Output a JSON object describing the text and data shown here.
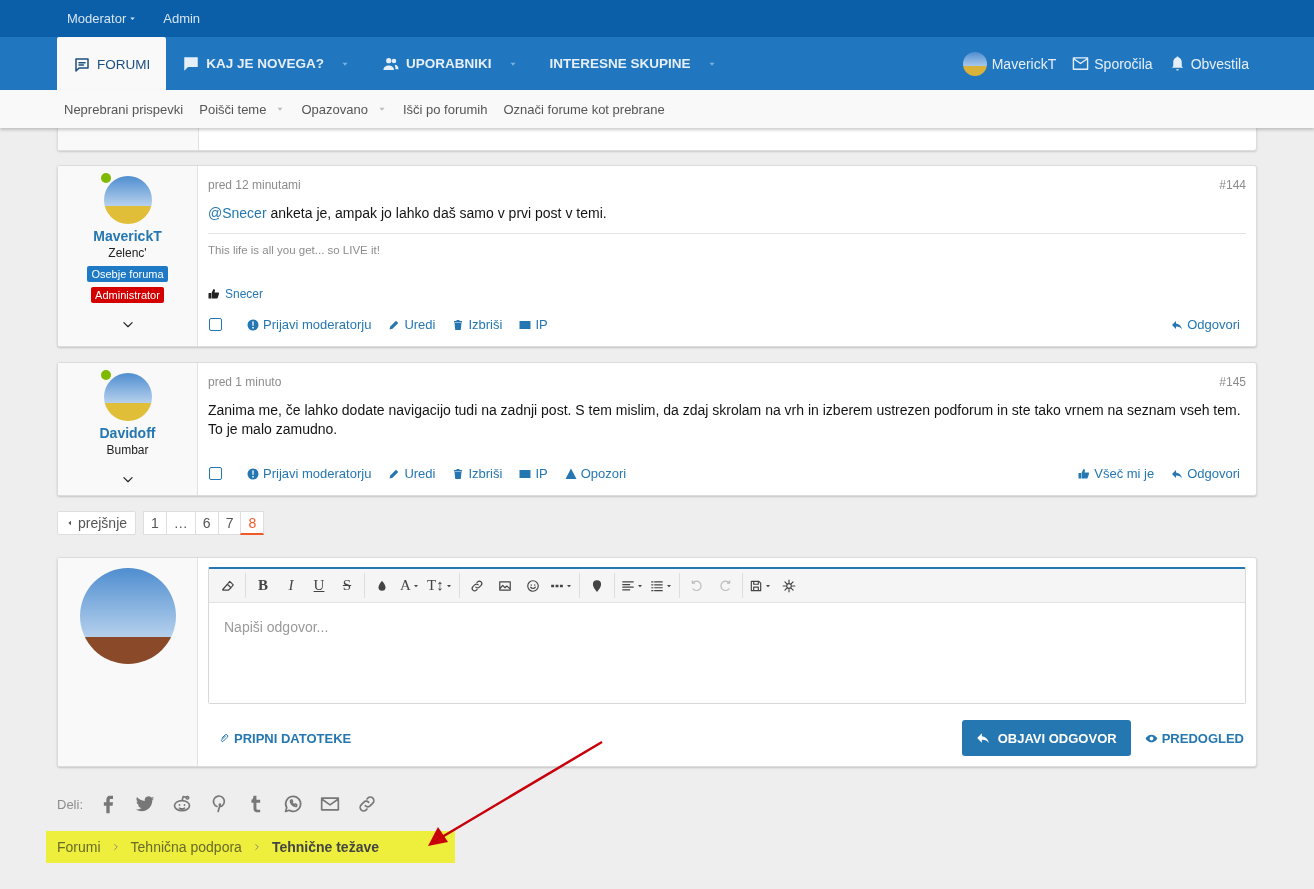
{
  "top_bar": [
    {
      "label": "Moderator",
      "dropdown": true
    },
    {
      "label": "Admin",
      "dropdown": false
    }
  ],
  "main_nav": {
    "tabs": [
      {
        "kind": "forums",
        "label": "FORUMI",
        "selected": true,
        "dropdown": false
      },
      {
        "kind": "news",
        "label": "KAJ JE NOVEGA?",
        "selected": false,
        "dropdown": true
      },
      {
        "kind": "members",
        "label": "UPORABNIKI",
        "selected": false,
        "dropdown": true
      },
      {
        "kind": "groups",
        "label": "INTERESNE SKUPINE",
        "selected": false,
        "dropdown": true
      }
    ],
    "user": "MaverickT",
    "links": [
      {
        "kind": "messages",
        "label": "Sporočila"
      },
      {
        "kind": "alerts",
        "label": "Obvestila"
      }
    ]
  },
  "sub_nav": [
    {
      "label": "Neprebrani prispevki",
      "dropdown": false
    },
    {
      "label": "Poišči teme",
      "dropdown": true
    },
    {
      "label": "Opazovano",
      "dropdown": true
    },
    {
      "label": "Išči po forumih",
      "dropdown": false
    },
    {
      "label": "Označi forume kot prebrane",
      "dropdown": false
    }
  ],
  "posts": [
    {
      "user": "MaverickT",
      "online": true,
      "user_title": "Zelenc'",
      "badges": [
        {
          "label": "Osebje foruma",
          "color": "#1e7ac5"
        },
        {
          "label": "Administrator",
          "color": "#d40000"
        }
      ],
      "time": "pred 12 minutami",
      "number": "#144",
      "mention": "@Snecer",
      "body": "anketa je, ampak jo lahko daš samo v prvi post v temi.",
      "signature": "This life is all you get... so LIVE it!",
      "liked_by": "Snecer",
      "checked": false,
      "actions": [
        {
          "kind": "report",
          "label": "Prijavi moderatorju"
        },
        {
          "kind": "edit",
          "label": "Uredi"
        },
        {
          "kind": "delete",
          "label": "Izbriši"
        },
        {
          "kind": "ip",
          "label": "IP"
        }
      ],
      "right_actions": [
        {
          "kind": "reply",
          "label": "Odgovori"
        }
      ]
    },
    {
      "user": "Davidoff",
      "online": true,
      "user_title": "Bumbar",
      "time": "pred 1 minuto",
      "number": "#145",
      "body": "Zanima me, če lahko dodate navigacijo tudi na zadnji post. S tem mislim, da zdaj skrolam na vrh in izberem ustrezen podforum in ste tako vrnem na seznam vseh tem. To je malo zamudno.",
      "checked": false,
      "actions": [
        {
          "kind": "report",
          "label": "Prijavi moderatorju"
        },
        {
          "kind": "edit",
          "label": "Uredi"
        },
        {
          "kind": "delete",
          "label": "Izbriši"
        },
        {
          "kind": "ip",
          "label": "IP"
        },
        {
          "kind": "warn",
          "label": "Opozori"
        }
      ],
      "right_actions": [
        {
          "kind": "like",
          "label": "Všeč mi je"
        },
        {
          "kind": "reply",
          "label": "Odgovori"
        }
      ]
    }
  ],
  "pagination": {
    "prev": "prejšnje",
    "pages": [
      {
        "label": "1",
        "selected": false
      },
      {
        "label": "…",
        "selected": false
      },
      {
        "label": "6",
        "selected": false
      },
      {
        "label": "7",
        "selected": false
      },
      {
        "label": "8",
        "selected": true
      }
    ]
  },
  "reply": {
    "toolbar": [
      [
        {
          "kind": "eraser",
          "dropdown": false,
          "disabled": false
        }
      ],
      [
        {
          "kind": "bold",
          "label": "B",
          "dropdown": false,
          "disabled": false
        },
        {
          "kind": "italic",
          "label": "I",
          "dropdown": false,
          "disabled": false
        },
        {
          "kind": "underline",
          "label": "U",
          "dropdown": false,
          "disabled": false
        },
        {
          "kind": "strike",
          "label": "S",
          "dropdown": false,
          "disabled": false
        }
      ],
      [
        {
          "kind": "color",
          "dropdown": false,
          "disabled": false
        },
        {
          "kind": "font",
          "label": "A",
          "dropdown": true,
          "disabled": false
        },
        {
          "kind": "size",
          "label": "T↕",
          "dropdown": true,
          "disabled": false
        }
      ],
      [
        {
          "kind": "link",
          "dropdown": false,
          "disabled": false
        },
        {
          "kind": "image",
          "dropdown": false,
          "disabled": false
        },
        {
          "kind": "smiley",
          "dropdown": false,
          "disabled": false
        },
        {
          "kind": "more",
          "dropdown": true,
          "disabled": false
        }
      ],
      [
        {
          "kind": "pin",
          "dropdown": false,
          "disabled": false
        }
      ],
      [
        {
          "kind": "align",
          "dropdown": true,
          "disabled": false
        },
        {
          "kind": "list",
          "dropdown": true,
          "disabled": false
        }
      ],
      [
        {
          "kind": "undo",
          "dropdown": false,
          "disabled": true
        },
        {
          "kind": "redo",
          "dropdown": false,
          "disabled": true
        }
      ],
      [
        {
          "kind": "save",
          "dropdown": true,
          "disabled": false
        },
        {
          "kind": "gear",
          "dropdown": false,
          "disabled": false
        }
      ]
    ],
    "placeholder": "Napiši odgovor...",
    "attach": "PRIPNI DATOTEKE",
    "submit": "OBJAVI ODGOVOR",
    "preview": "PREDOGLED"
  },
  "share": {
    "label": "Deli:"
  },
  "breadcrumb": [
    {
      "label": "Forumi",
      "current": false
    },
    {
      "label": "Tehnična podpora",
      "current": false
    },
    {
      "label": "Tehnične težave",
      "current": true
    }
  ]
}
